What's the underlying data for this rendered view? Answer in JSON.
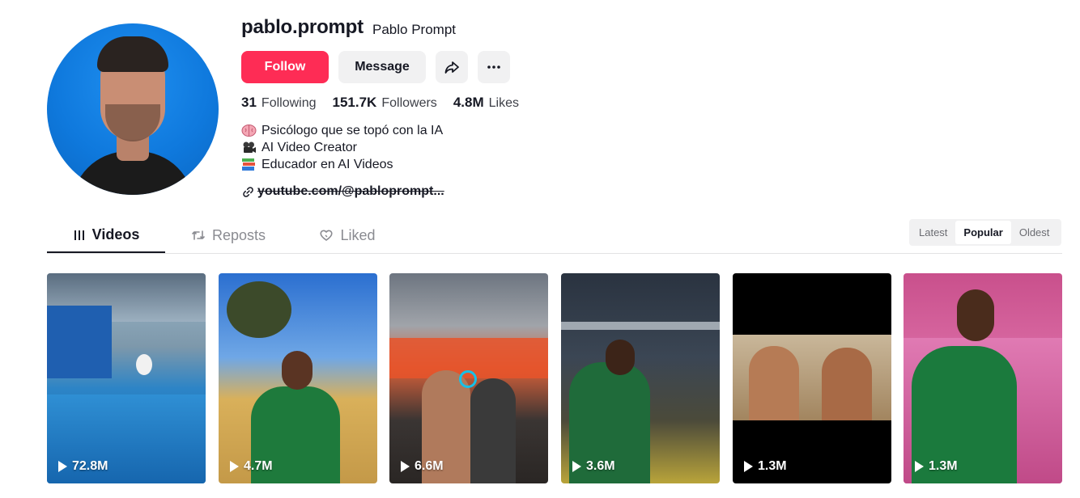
{
  "profile": {
    "username": "pablo.prompt",
    "nickname": "Pablo Prompt",
    "follow_label": "Follow",
    "message_label": "Message",
    "stats": {
      "following_count": "31",
      "following_label": "Following",
      "followers_count": "151.7K",
      "followers_label": "Followers",
      "likes_count": "4.8M",
      "likes_label": "Likes"
    },
    "bio": [
      {
        "icon": "brain-emoji",
        "text": "Psicólogo que se topó con la IA"
      },
      {
        "icon": "camera-emoji",
        "text": "AI Video Creator"
      },
      {
        "icon": "books-emoji",
        "text": "Educador en AI Videos"
      }
    ],
    "link": "youtube.com/@pabloprompt..."
  },
  "tabs": [
    {
      "label": "Videos",
      "icon": "grid-icon",
      "active": true
    },
    {
      "label": "Reposts",
      "icon": "repost-icon",
      "active": false
    },
    {
      "label": "Liked",
      "icon": "heart-icon",
      "active": false
    }
  ],
  "sort": {
    "options": [
      "Latest",
      "Popular",
      "Oldest"
    ],
    "selected": "Popular"
  },
  "videos": [
    {
      "views": "72.8M"
    },
    {
      "views": "4.7M"
    },
    {
      "views": "6.6M"
    },
    {
      "views": "3.6M"
    },
    {
      "views": "1.3M"
    },
    {
      "views": "1.3M"
    }
  ],
  "colors": {
    "accent": "#fe2c55",
    "button_bg": "#f1f1f2",
    "text": "#161823",
    "muted": "#8a8b91"
  }
}
